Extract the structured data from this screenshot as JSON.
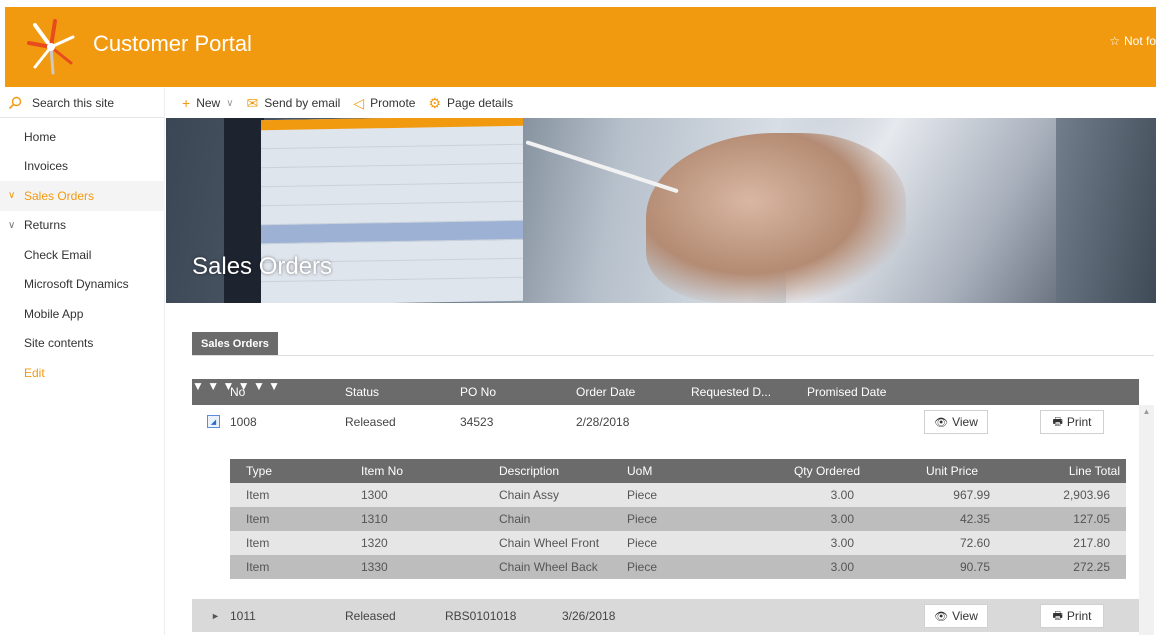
{
  "header": {
    "site_title": "Customer Portal",
    "follow_label": "Not fo",
    "logo_name": "company-logo"
  },
  "search": {
    "placeholder": "Search this site"
  },
  "nav": {
    "items": [
      {
        "label": "Home"
      },
      {
        "label": "Invoices"
      },
      {
        "label": "Sales Orders"
      },
      {
        "label": "Returns"
      },
      {
        "label": "Check Email"
      },
      {
        "label": "Microsoft Dynamics"
      },
      {
        "label": "Mobile App"
      },
      {
        "label": "Site contents"
      },
      {
        "label": "Edit"
      }
    ]
  },
  "commands": {
    "new": "New",
    "send_email": "Send by email",
    "promote": "Promote",
    "page_details": "Page details"
  },
  "hero": {
    "title": "Sales Orders"
  },
  "tab": {
    "label": "Sales Orders"
  },
  "grid": {
    "columns": [
      "No",
      "Status",
      "PO No",
      "Order Date",
      "Requested D...",
      "Promised Date"
    ],
    "orders": [
      {
        "no": "1008",
        "status": "Released",
        "po": "34523",
        "order_date": "2/28/2018",
        "view": "View",
        "print": "Print"
      },
      {
        "no": "1011",
        "status": "Released",
        "po": "RBS0101018",
        "order_date": "3/26/2018",
        "view": "View",
        "print": "Print"
      }
    ],
    "lines": {
      "columns": [
        "Type",
        "Item No",
        "Description",
        "UoM",
        "Qty Ordered",
        "Unit Price",
        "Line Total"
      ],
      "rows": [
        {
          "type": "Item",
          "item_no": "1300",
          "description": "Chain Assy",
          "uom": "Piece",
          "qty": "3.00",
          "unit_price": "967.99",
          "line_total": "2,903.96"
        },
        {
          "type": "Item",
          "item_no": "1310",
          "description": "Chain",
          "uom": "Piece",
          "qty": "3.00",
          "unit_price": "42.35",
          "line_total": "127.05"
        },
        {
          "type": "Item",
          "item_no": "1320",
          "description": "Chain Wheel Front",
          "uom": "Piece",
          "qty": "3.00",
          "unit_price": "72.60",
          "line_total": "217.80"
        },
        {
          "type": "Item",
          "item_no": "1330",
          "description": "Chain Wheel Back",
          "uom": "Piece",
          "qty": "3.00",
          "unit_price": "90.75",
          "line_total": "272.25"
        }
      ]
    }
  },
  "colors": {
    "brand": "#f29a0f",
    "header_gray": "#6b6b6b"
  }
}
